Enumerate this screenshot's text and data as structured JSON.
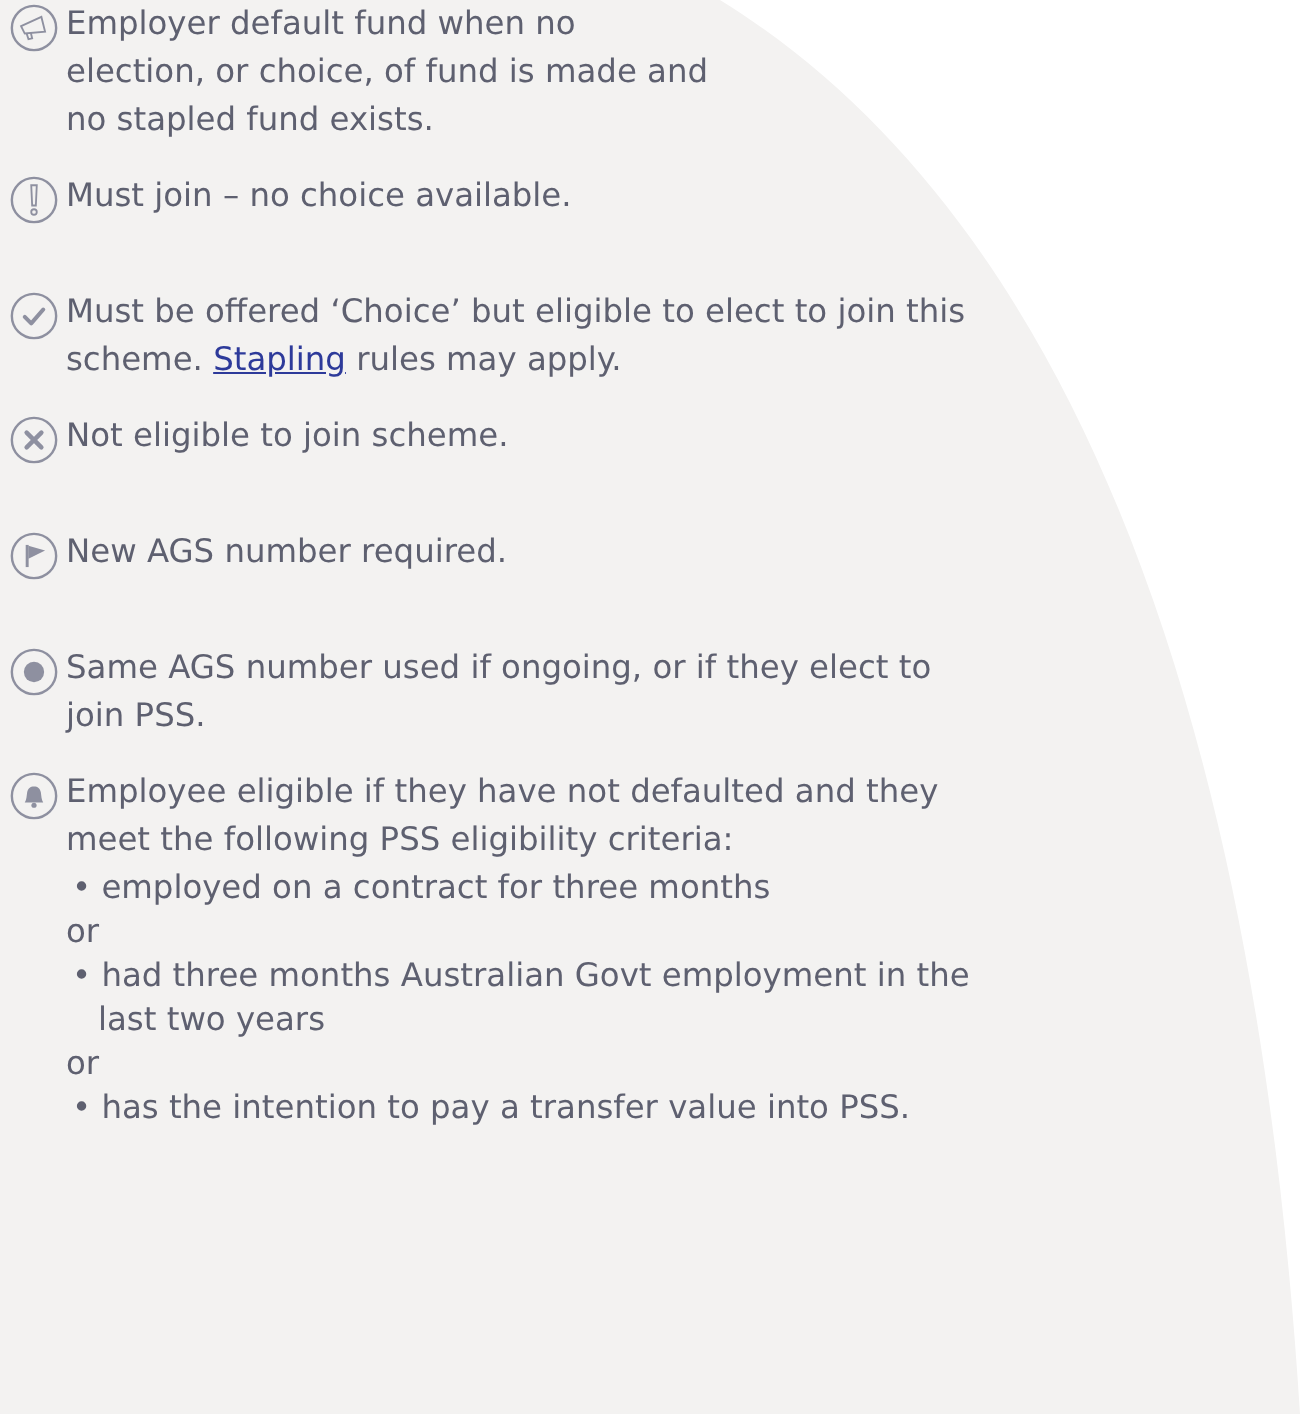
{
  "items": [
    {
      "kind": "megaphone",
      "segments": [
        {
          "kind": "text",
          "text": "Employer default fund when no\nelection, or choice, of fund is made and\nno stapled fund exists."
        }
      ]
    },
    {
      "kind": "exclamation",
      "segments": [
        {
          "kind": "text",
          "text": "Must join – no choice available."
        }
      ]
    },
    {
      "kind": "check",
      "segments": [
        {
          "kind": "text",
          "text": "Must be offered ‘Choice’ but eligible to elect to join this\nscheme. "
        },
        {
          "kind": "link",
          "text": "Stapling"
        },
        {
          "kind": "text",
          "text": " rules may apply."
        }
      ]
    },
    {
      "kind": "cross",
      "segments": [
        {
          "kind": "text",
          "text": "Not eligible to join scheme."
        }
      ]
    },
    {
      "kind": "flag",
      "segments": [
        {
          "kind": "text",
          "text": "New AGS number required."
        }
      ]
    },
    {
      "kind": "dot",
      "segments": [
        {
          "kind": "text",
          "text": "Same AGS number used if ongoing, or if they elect to\njoin PSS."
        }
      ]
    },
    {
      "kind": "bell",
      "segments": [
        {
          "kind": "text",
          "text": "Employee eligible if they have not defaulted and they\nmeet the following PSS eligibility criteria:"
        }
      ],
      "sublines": [
        {
          "kind": "bullet",
          "mark": "•",
          "text": "employed on a contract for three months"
        },
        {
          "kind": "or",
          "text": "or"
        },
        {
          "kind": "bullet",
          "mark": "•",
          "text": "had three months Australian Govt employment in the\nlast two years"
        },
        {
          "kind": "or",
          "text": "or"
        },
        {
          "kind": "bullet",
          "mark": "•",
          "text": "has the intention to pay a transfer value into PSS."
        }
      ]
    }
  ]
}
